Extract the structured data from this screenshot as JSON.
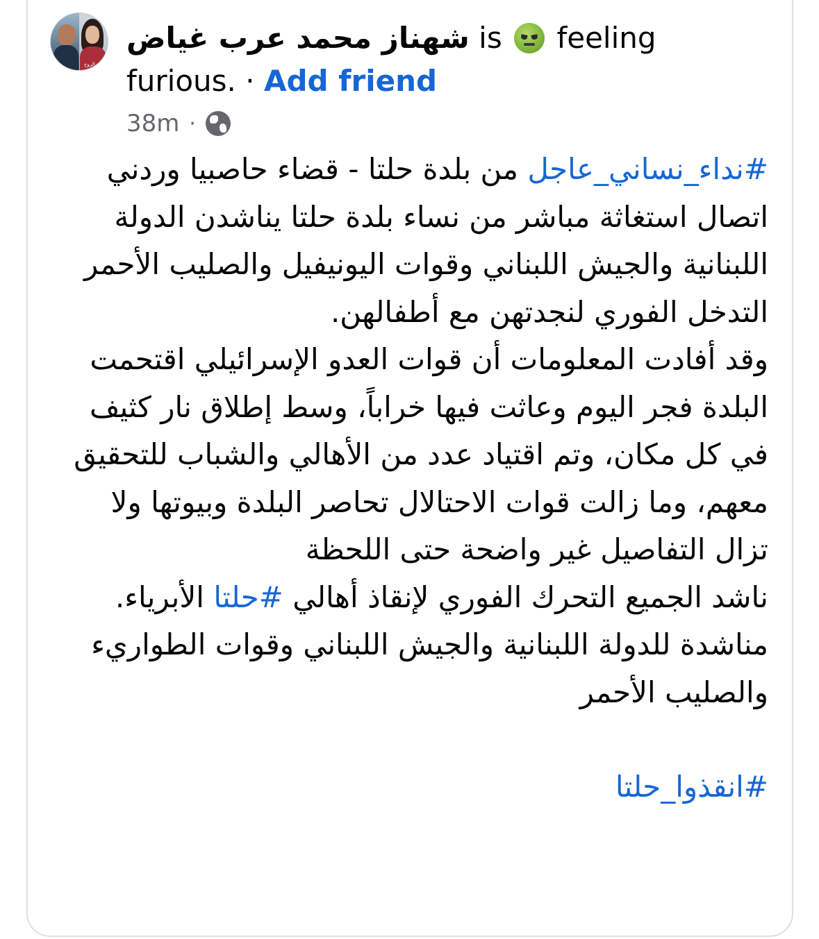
{
  "post": {
    "author_name": "شهناز محمد عرب غياض",
    "is_text": "is",
    "feeling_emoji": "furious-face-icon",
    "feeling_text_1": "feeling",
    "feeling_text_2": "furious.",
    "separator": "·",
    "add_friend_label": "Add friend",
    "time": "38m",
    "meta_separator": "·",
    "privacy_icon": "globe-icon",
    "avatar_caption": "روح الروح",
    "body": {
      "p1_hashtag": "#نداء_نساني_عاجل",
      "p1_text": " من بلدة حلتا - قضاء حاصبيا وردني اتصال استغاثة مباشر من نساء بلدة حلتا يناشدن الدولة اللبنانية والجيش اللبناني وقوات اليونيفيل والصليب الأحمر التدخل الفوري لنجدتهن مع أطفالهن.",
      "p2_text": " وقد أفادت المعلومات أن قوات العدو الإسرائيلي اقتحمت البلدة فجر اليوم وعاثت فيها خراباً، وسط إطلاق نار كثيف في كل مكان، وتم اقتياد عدد من الأهالي والشباب للتحقيق معهم،  وما زالت قوات الاحتالال تحاصر البلدة وبيوتها ولا تزال التفاصيل غير واضحة حتى اللحظة",
      "p3_text_before": "ناشد الجميع التحرك الفوري لإنقاذ أهالي ",
      "p3_hashtag": "#حلتا",
      "p3_text_after": " الأبرياء.",
      "p4_text": "مناشدة للدولة اللبنانية والجيش اللبناني وقوات الطواريء والصليب الأحمر",
      "p5_hashtag": "#انقذوا_حلتا"
    }
  },
  "colors": {
    "link": "#1666d5",
    "meta": "#65676b",
    "text": "#050505",
    "border": "#dddfe2"
  }
}
